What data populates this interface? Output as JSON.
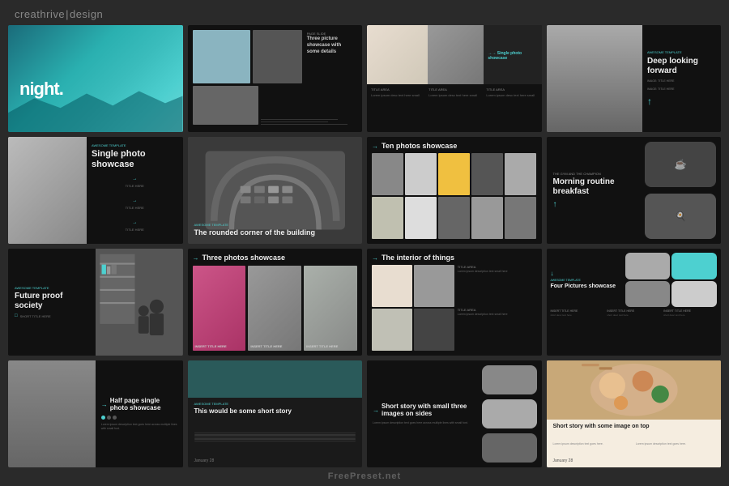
{
  "brand": {
    "name": "creathrive",
    "separator": "|",
    "suffix": "design"
  },
  "slides": [
    {
      "id": 1,
      "type": "title",
      "title": "night.",
      "bg": "teal-gradient"
    },
    {
      "id": 2,
      "type": "three-picture-showcase",
      "label": "PAGE SLIDE",
      "title": "Three picture showcase with some details"
    },
    {
      "id": 3,
      "type": "single-photo-showcase",
      "top_label": "→ Single photo showcase",
      "col_labels": [
        "TITLE AREA",
        "TITLE AREA",
        "TITLE AREA"
      ]
    },
    {
      "id": 4,
      "type": "deep-looking",
      "template_label": "AWESOME TEMPLATE",
      "title": "Deep looking forward"
    },
    {
      "id": 5,
      "type": "single-photo-2",
      "template_label": "AWESOME TEMPLATE",
      "title": "Single photo showcase",
      "item1": "TITLE HERE",
      "item2": "TITLE HERE",
      "item3": "TITLE HERE"
    },
    {
      "id": 6,
      "type": "rounded-corner",
      "template_label": "AWESOME TEMPLATE",
      "title": "The rounded corner of the building"
    },
    {
      "id": 7,
      "type": "ten-photos",
      "top_label": "→",
      "title": "Ten photos showcase"
    },
    {
      "id": 8,
      "type": "morning-routine",
      "label": "THE GYM AND THE CHAMPION",
      "title": "Morning routine breakfast"
    },
    {
      "id": 9,
      "type": "future-proof",
      "template_label": "AWESOME TEMPLATE",
      "title": "Future proof society"
    },
    {
      "id": 10,
      "type": "three-photos-showcase",
      "top_label": "→",
      "title": "Three photos showcase",
      "photo_labels": [
        "INSERT TITLE HERE",
        "INSERT TITLE HERE",
        "INSERT TITLE HERE"
      ]
    },
    {
      "id": 11,
      "type": "interior",
      "top_label": "→",
      "title": "The interior of things",
      "col_labels": [
        "TITLE AREA",
        "TITLE AREA"
      ]
    },
    {
      "id": 12,
      "type": "four-pictures",
      "template_label": "AWESOME TEMPLATE",
      "title": "Four Pictures showcase"
    },
    {
      "id": 13,
      "type": "half-page",
      "title": "Half page single photo showcase",
      "dots": 3
    },
    {
      "id": 14,
      "type": "short-story-text",
      "template_label": "AWESOME TEMPLATE",
      "title": "This would be some short story",
      "date": "January 28"
    },
    {
      "id": 15,
      "type": "short-story-images",
      "top_label": "→",
      "title": "Short story with small three images on sides"
    },
    {
      "id": 16,
      "type": "short-story-top-image",
      "title": "Short story with some image on top",
      "date": "January 28"
    }
  ],
  "watermark": "FreePreset.net"
}
